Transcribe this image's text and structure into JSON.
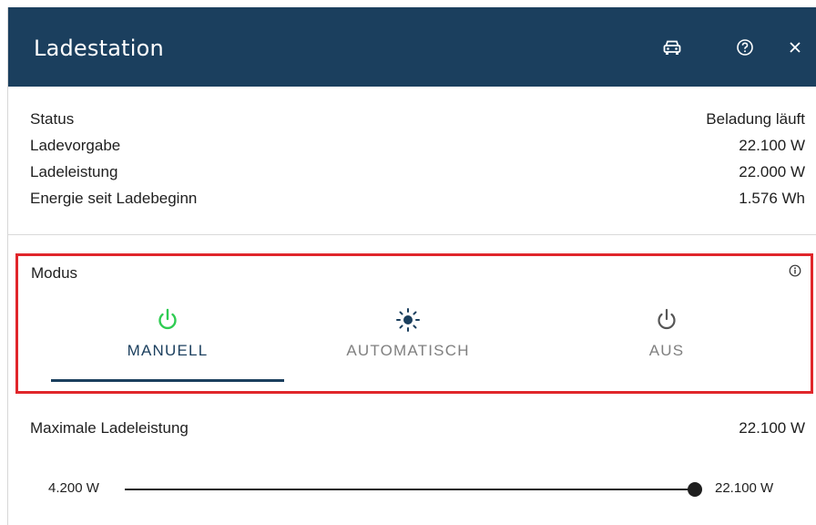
{
  "header": {
    "title": "Ladestation",
    "icons": [
      "car-icon",
      "help-icon",
      "close-icon"
    ]
  },
  "status": [
    {
      "label": "Status",
      "value": "Beladung läuft"
    },
    {
      "label": "Ladevorgabe",
      "value": "22.100 W"
    },
    {
      "label": "Ladeleistung",
      "value": "22.000 W"
    },
    {
      "label": "Energie seit Ladebeginn",
      "value": "1.576 Wh"
    }
  ],
  "modus": {
    "label": "Modus",
    "info_icon": "info-icon",
    "tabs": [
      {
        "label": "MANUELL",
        "icon": "power-icon",
        "active": true
      },
      {
        "label": "AUTOMATISCH",
        "icon": "sun-icon",
        "active": false
      },
      {
        "label": "AUS",
        "icon": "power-icon",
        "active": false
      }
    ]
  },
  "max_power": {
    "label": "Maximale Ladeleistung",
    "value": "22.100 W",
    "slider_min": "4.200 W",
    "slider_max": "22.100 W",
    "slider_fraction": 1.0
  },
  "colors": {
    "header_bg": "#1b3f5e",
    "active_icon": "#2ecc52",
    "highlight_border": "#e0262b"
  }
}
